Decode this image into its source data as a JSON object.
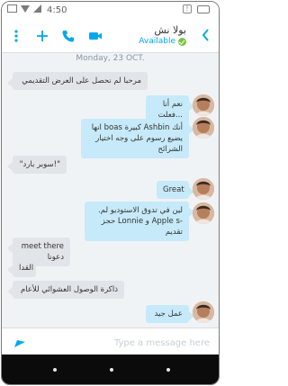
{
  "status_bar": {
    "time": "4:50"
  },
  "header": {
    "contact_name": "بولا نش",
    "status": "Available",
    "accent_color": "#00a8ec"
  },
  "date_separator": "Monday, 23 OCT.",
  "messages": [
    {
      "direction": "out",
      "text": "مرحبا لم نحصل على العرض التقديمي"
    },
    {
      "direction": "in",
      "text": "نعم أنا فعلت..."
    },
    {
      "direction": "in",
      "text": "انها boas كبيرة Ashbin أنك يضيع رسوم على وجه اختيار الشرائح"
    },
    {
      "direction": "out",
      "text": "\"سوبر بارد!\""
    },
    {
      "direction": "in",
      "text": "Great"
    },
    {
      "direction": "in",
      "text": "لين في تدوق الاستوديو لم. حجز Lonnie و Apple s- تقديم"
    },
    {
      "direction": "out",
      "text": "meet there دعونا"
    },
    {
      "direction": "out",
      "text": "القدا"
    },
    {
      "direction": "out",
      "text": "ذاكرة الوصول العشوائي للأعام"
    },
    {
      "direction": "in",
      "text": "عمل جيد"
    }
  ],
  "compose": {
    "placeholder": "Type a message here"
  },
  "icons": {
    "back": "chevron-left-icon",
    "call": "phone-icon",
    "video": "video-camera-icon",
    "add": "add-icon",
    "more": "more-vertical-icon",
    "send": "send-icon",
    "presence": "check-icon"
  }
}
